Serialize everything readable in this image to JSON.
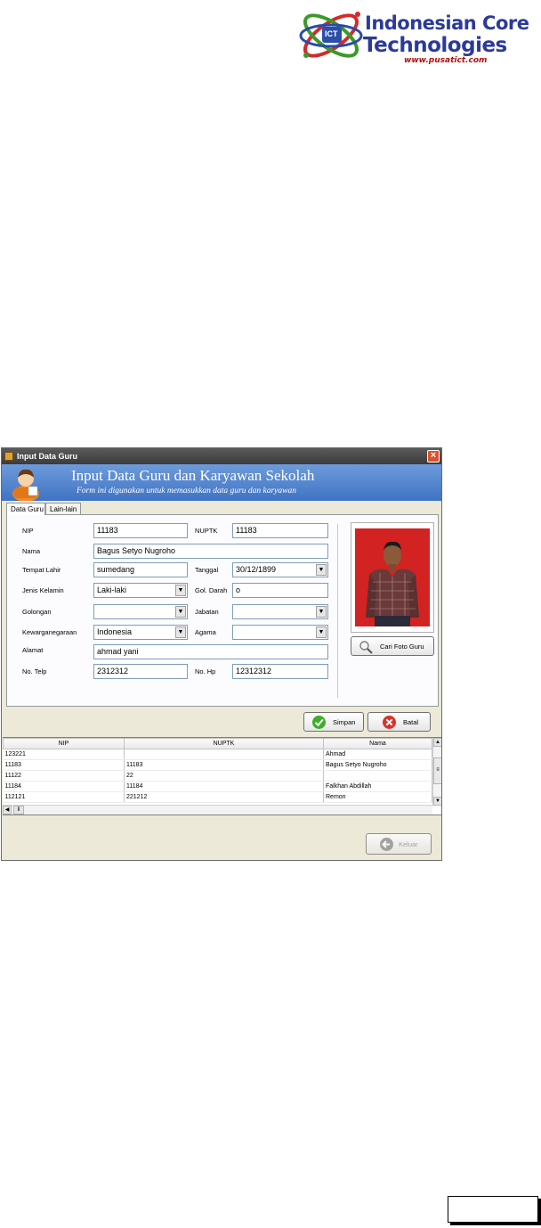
{
  "logo": {
    "line1": "Indonesian Core",
    "line2": "Technologies",
    "url": "www.pusatict.com",
    "mark": "ICT"
  },
  "window": {
    "title": "Input Data Guru",
    "close_label": "×",
    "banner_title": "Input Data Guru dan Karyawan Sekolah",
    "banner_subtitle": "Form ini digunakan untuk memasukkan data guru dan karyawan"
  },
  "tabs": [
    {
      "label": "Data Guru",
      "active": true
    },
    {
      "label": "Lain-lain",
      "active": false
    }
  ],
  "form": {
    "nip": {
      "label": "NIP",
      "value": "11183"
    },
    "nuptk": {
      "label": "NUPTK",
      "value": "11183"
    },
    "nama": {
      "label": "Nama",
      "value": "Bagus Setyo Nugroho"
    },
    "tempat_lahir": {
      "label": "Tempat Lahir",
      "value": "sumedang"
    },
    "tanggal": {
      "label": "Tanggal",
      "value": "30/12/1899"
    },
    "jenis_kelamin": {
      "label": "Jenis Kelamin",
      "value": "Laki-laki"
    },
    "gol_darah": {
      "label": "Gol. Darah",
      "value": "o"
    },
    "golongan": {
      "label": "Golongan",
      "value": ""
    },
    "jabatan": {
      "label": "Jabatan",
      "value": ""
    },
    "kewarganegaraan": {
      "label": "Kewarganegaraan",
      "value": "Indonesia"
    },
    "agama": {
      "label": "Agama",
      "value": ""
    },
    "alamat": {
      "label": "Alamat",
      "value": "ahmad yani"
    },
    "no_telp": {
      "label": "No. Telp",
      "value": "2312312"
    },
    "no_hp": {
      "label": "No. Hp",
      "value": "12312312"
    }
  },
  "buttons": {
    "cari_foto": "Cari Foto Guru",
    "simpan": "Simpan",
    "batal": "Batal",
    "keluar": "Keluar"
  },
  "grid": {
    "columns": [
      "NIP",
      "NUPTK",
      "Nama"
    ],
    "rows": [
      [
        "123221",
        "",
        "Ahmad"
      ],
      [
        "11183",
        "11183",
        "Bagus Setyo Nugroho"
      ],
      [
        "11122",
        "22",
        ""
      ],
      [
        "11184",
        "11184",
        "Falkhan Abdillah"
      ],
      [
        "112121",
        "221212",
        "Remon"
      ]
    ]
  },
  "colors": {
    "banner": "#4a7fcc",
    "title_bar": "#4a4a4a",
    "close": "#d9522b",
    "window_bg": "#ece9d8",
    "photo_bg": "#d42020"
  }
}
